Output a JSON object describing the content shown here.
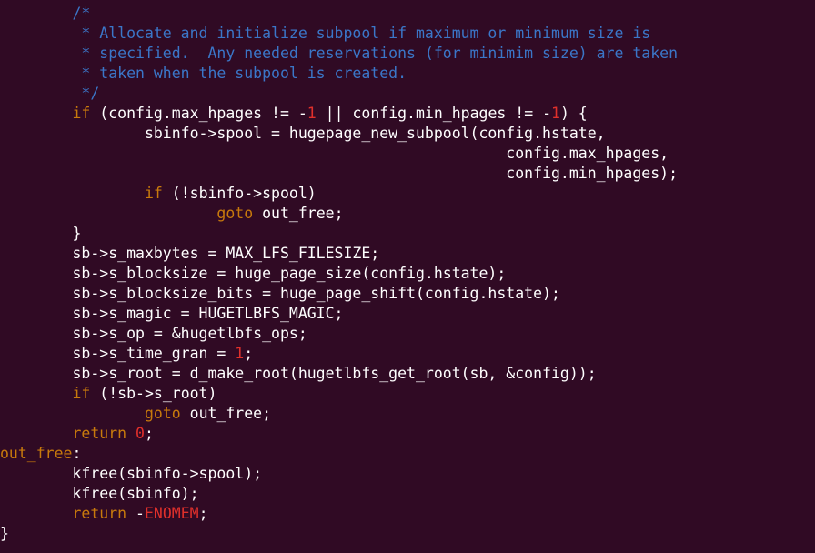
{
  "colors": {
    "background": "#300a24",
    "text": "#ffffff",
    "comment": "#3b76c8",
    "keyword": "#c87a0c",
    "number": "#e0302b",
    "label": "#c87a0c"
  },
  "lines": [
    [
      {
        "k": "t",
        "s": "        "
      },
      {
        "k": "c",
        "s": "/*"
      }
    ],
    [
      {
        "k": "c",
        "s": "         * Allocate and initialize subpool if maximum or minimum size is"
      }
    ],
    [
      {
        "k": "c",
        "s": "         * specified.  Any needed reservations (for minimim size) are taken"
      }
    ],
    [
      {
        "k": "c",
        "s": "         * taken when the subpool is created."
      }
    ],
    [
      {
        "k": "c",
        "s": "         */"
      }
    ],
    [
      {
        "k": "t",
        "s": "        "
      },
      {
        "k": "k",
        "s": "if"
      },
      {
        "k": "t",
        "s": " (config.max_hpages != -"
      },
      {
        "k": "n",
        "s": "1"
      },
      {
        "k": "t",
        "s": " || config.min_hpages != -"
      },
      {
        "k": "n",
        "s": "1"
      },
      {
        "k": "t",
        "s": ") {"
      }
    ],
    [
      {
        "k": "t",
        "s": "                sbinfo->spool = hugepage_new_subpool(config.hstate,"
      }
    ],
    [
      {
        "k": "t",
        "s": "                                                        config.max_hpages,"
      }
    ],
    [
      {
        "k": "t",
        "s": "                                                        config.min_hpages);"
      }
    ],
    [
      {
        "k": "t",
        "s": "                "
      },
      {
        "k": "k",
        "s": "if"
      },
      {
        "k": "t",
        "s": " (!sbinfo->spool)"
      }
    ],
    [
      {
        "k": "t",
        "s": "                        "
      },
      {
        "k": "k",
        "s": "goto"
      },
      {
        "k": "t",
        "s": " out_free;"
      }
    ],
    [
      {
        "k": "t",
        "s": "        }"
      }
    ],
    [
      {
        "k": "t",
        "s": "        sb->s_maxbytes = MAX_LFS_FILESIZE;"
      }
    ],
    [
      {
        "k": "t",
        "s": "        sb->s_blocksize = huge_page_size(config.hstate);"
      }
    ],
    [
      {
        "k": "t",
        "s": "        sb->s_blocksize_bits = huge_page_shift(config.hstate);"
      }
    ],
    [
      {
        "k": "t",
        "s": "        sb->s_magic = HUGETLBFS_MAGIC;"
      }
    ],
    [
      {
        "k": "t",
        "s": "        sb->s_op = &hugetlbfs_ops;"
      }
    ],
    [
      {
        "k": "t",
        "s": "        sb->s_time_gran = "
      },
      {
        "k": "n",
        "s": "1"
      },
      {
        "k": "t",
        "s": ";"
      }
    ],
    [
      {
        "k": "t",
        "s": "        sb->s_root = d_make_root(hugetlbfs_get_root(sb, &config));"
      }
    ],
    [
      {
        "k": "t",
        "s": "        "
      },
      {
        "k": "k",
        "s": "if"
      },
      {
        "k": "t",
        "s": " (!sb->s_root)"
      }
    ],
    [
      {
        "k": "t",
        "s": "                "
      },
      {
        "k": "k",
        "s": "goto"
      },
      {
        "k": "t",
        "s": " out_free;"
      }
    ],
    [
      {
        "k": "t",
        "s": "        "
      },
      {
        "k": "k",
        "s": "return"
      },
      {
        "k": "t",
        "s": " "
      },
      {
        "k": "n",
        "s": "0"
      },
      {
        "k": "t",
        "s": ";"
      }
    ],
    [
      {
        "k": "l",
        "s": "out_free"
      },
      {
        "k": "t",
        "s": ":"
      }
    ],
    [
      {
        "k": "t",
        "s": "        kfree(sbinfo->spool);"
      }
    ],
    [
      {
        "k": "t",
        "s": "        kfree(sbinfo);"
      }
    ],
    [
      {
        "k": "t",
        "s": "        "
      },
      {
        "k": "k",
        "s": "return"
      },
      {
        "k": "t",
        "s": " -"
      },
      {
        "k": "n",
        "s": "ENOMEM"
      },
      {
        "k": "t",
        "s": ";"
      }
    ],
    [
      {
        "k": "t",
        "s": "}"
      }
    ]
  ]
}
